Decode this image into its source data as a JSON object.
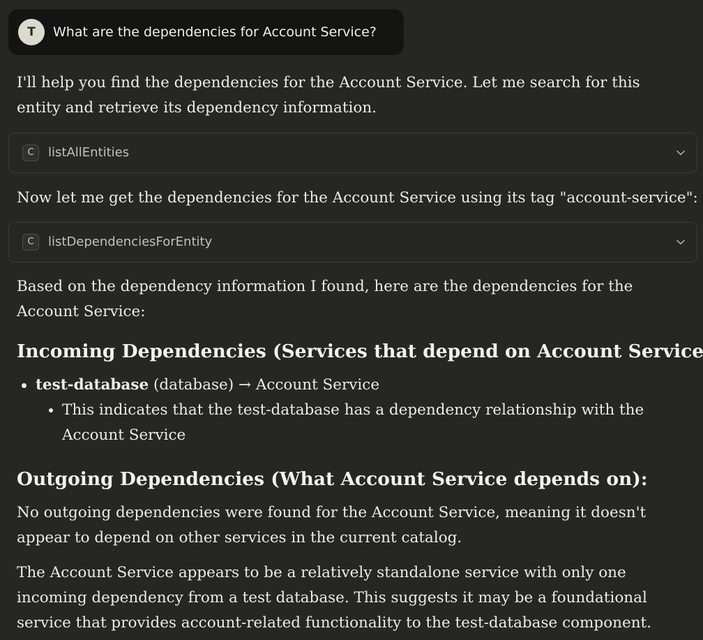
{
  "user_message": {
    "avatar_initial": "T",
    "text": "What are the dependencies for Account Service?"
  },
  "assistant": {
    "intro": "I'll help you find the dependencies for the Account Service. Let me search for this entity and retrieve its dependency information.",
    "tool_calls": [
      {
        "badge": "C",
        "name": "listAllEntities"
      },
      {
        "badge": "C",
        "name": "listDependenciesForEntity"
      }
    ],
    "followup": "Now let me get the dependencies for the Account Service using its tag \"account-service\":",
    "summary_intro": "Based on the dependency information I found, here are the dependencies for the Account Service:",
    "incoming": {
      "heading": "Incoming Dependencies (Services that depend on Account Service):",
      "item_bold": "test-database",
      "item_rest": " (database) → Account Service",
      "sub_item": "This indicates that the test-database has a dependency relationship with the Account Service"
    },
    "outgoing": {
      "heading": "Outgoing Dependencies (What Account Service depends on):",
      "text": "No outgoing dependencies were found for the Account Service, meaning it doesn't appear to depend on other services in the current catalog."
    },
    "conclusion": "The Account Service appears to be a relatively standalone service with only one incoming dependency from a test database. This suggests it may be a foundational service that provides account-related functionality to the test-database component."
  },
  "icons": {
    "expand": "chevron-down-icon"
  },
  "colors": {
    "background": "#262624",
    "user_bubble": "#141413",
    "text": "#ecebe6"
  }
}
